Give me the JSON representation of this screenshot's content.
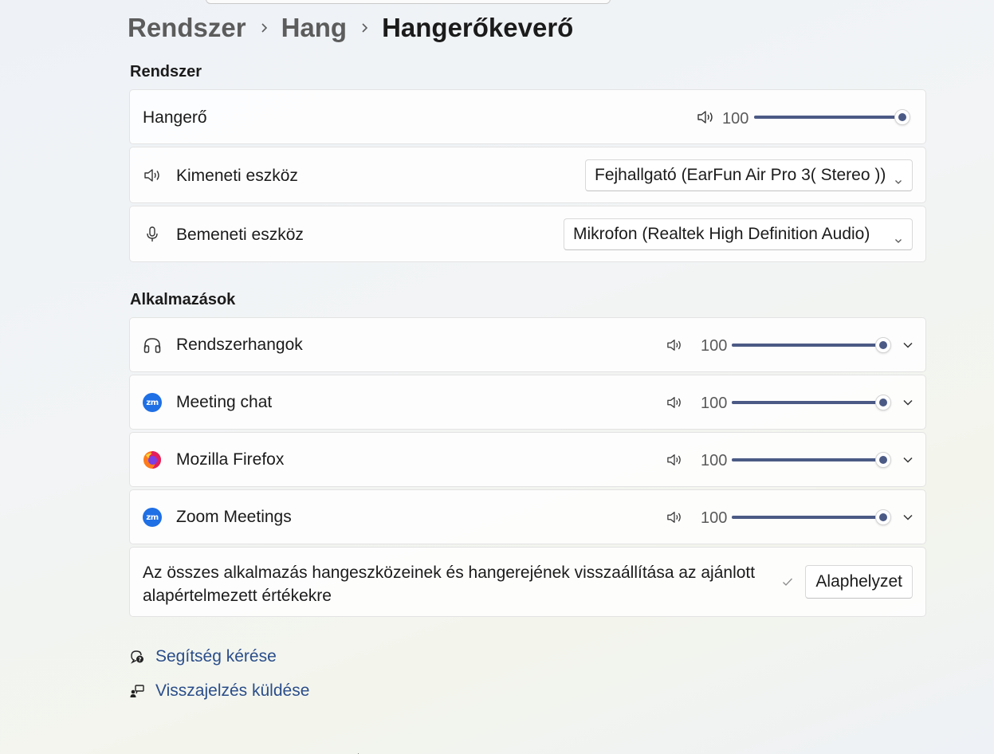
{
  "breadcrumb": {
    "items": [
      "Rendszer",
      "Hang"
    ],
    "current": "Hangerőkeverő"
  },
  "system_section": {
    "title": "Rendszer",
    "volume": {
      "label": "Hangerő",
      "value": "100",
      "level": 0.98,
      "icon": "speaker-icon"
    },
    "output": {
      "label": "Kimeneti eszköz",
      "selected": "Fejhallgató (EarFun Air Pro 3( Stereo ))",
      "icon": "speaker-icon"
    },
    "input": {
      "label": "Bemeneti eszköz",
      "selected": "Mikrofon (Realtek High Definition Audio)",
      "icon": "microphone-icon"
    }
  },
  "apps_section": {
    "title": "Alkalmazások",
    "apps": [
      {
        "name": "Rendszerhangok",
        "icon": "headphones-icon",
        "value": "100",
        "level": 1.0
      },
      {
        "name": "Meeting chat",
        "icon": "zoom-icon",
        "value": "100",
        "level": 1.0
      },
      {
        "name": "Mozilla Firefox",
        "icon": "firefox-icon",
        "value": "100",
        "level": 1.0
      },
      {
        "name": "Zoom Meetings",
        "icon": "zoom-icon",
        "value": "100",
        "level": 1.0
      }
    ],
    "reset": {
      "text": "Az összes alkalmazás hangeszközeinek és hangerejének visszaállítása az ajánlott alapértelmezett értékekre",
      "button": "Alaphelyzet"
    }
  },
  "links": {
    "help": "Segítség kérése",
    "feedback": "Visszajelzés küldése"
  },
  "colors": {
    "accent": "#4b5a85",
    "link": "#2a4d8a",
    "zoom": "#1f6fe5"
  }
}
